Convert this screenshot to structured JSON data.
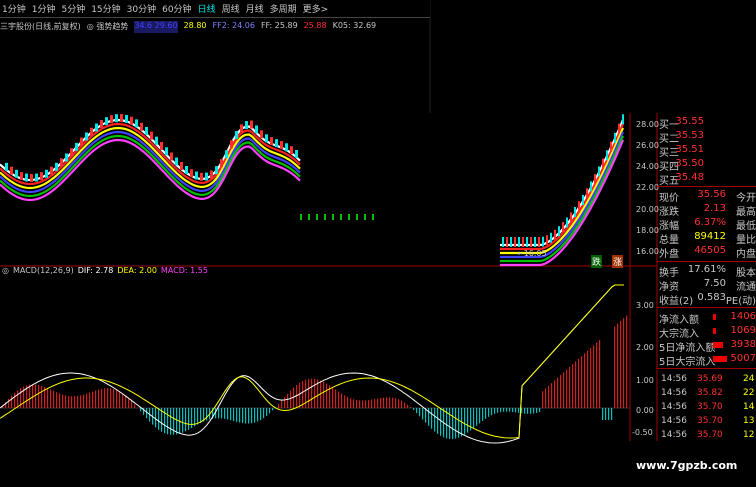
{
  "toolbar": {
    "tabs": [
      "1分钟",
      "1分钟",
      "5分钟",
      "15分钟",
      "30分钟",
      "60分钟",
      "日线",
      "周线",
      "月线",
      "多周期",
      "更多>"
    ],
    "active": "日线"
  },
  "indicator_info": {
    "title": "三宇股份(日线,前复权)",
    "indicator": "强势趋势",
    "values": [
      {
        "text": "34.6 29.60",
        "color": "#4040ff"
      },
      {
        "text": "28.80",
        "color": "#ffff00"
      },
      {
        "text": "FF2: 24.06",
        "color": "#8080ff"
      },
      {
        "text": "FF: 25.89",
        "color": "#c8c8c8"
      },
      {
        "text": "25.88",
        "color": "#ff3030"
      },
      {
        "text": "K05: 32.69",
        "color": "#c8c8c8"
      }
    ]
  },
  "price_axis": [
    "28.00",
    "26.00",
    "24.00",
    "22.00",
    "20.00",
    "18.00",
    "16.00"
  ],
  "low_marker": "16.05",
  "macd_legend": {
    "name": "MACD(12,26,9)",
    "dif": "DIF: 2.78",
    "dea": "DEA: 2.00",
    "macd": "MACD: 1.55"
  },
  "macd_axis": [
    "3.00",
    "2.00",
    "1.00",
    "0.00",
    "-0.50"
  ],
  "quote_panel": {
    "bids": [
      {
        "label": "买一",
        "price": "35.55"
      },
      {
        "label": "买二",
        "price": "35.53"
      },
      {
        "label": "买三",
        "price": "35.51"
      },
      {
        "label": "买四",
        "price": "35.50"
      },
      {
        "label": "买五",
        "price": "35.48"
      }
    ],
    "stats": [
      {
        "label": "现价",
        "value": "35.56",
        "label2": "今开",
        "color": "#ff3030"
      },
      {
        "label": "涨跌",
        "value": "2.13",
        "label2": "最高",
        "color": "#ff3030"
      },
      {
        "label": "涨幅",
        "value": "6.37%",
        "label2": "最低",
        "color": "#ff3030"
      },
      {
        "label": "总量",
        "value": "89412",
        "label2": "量比",
        "color": "#ffff00"
      },
      {
        "label": "外盘",
        "value": "46505",
        "label2": "内盘",
        "color": "#ff3030"
      }
    ],
    "turnover": [
      {
        "label": "换手",
        "value": "17.61%",
        "label2": "股本"
      },
      {
        "label": "净资",
        "value": "7.50",
        "label2": "流通"
      },
      {
        "label": "收益(2)",
        "value": "0.583",
        "label2": "PE(动)"
      }
    ],
    "flows": [
      {
        "label": "净流入额",
        "value": "1406"
      },
      {
        "label": "大宗流入",
        "value": "1069"
      },
      {
        "label": "5日净流入额",
        "value": "3938"
      },
      {
        "label": "5日大宗流入",
        "value": "5007"
      }
    ],
    "ticks": [
      {
        "time": "14:56",
        "price": "35.69",
        "vol": "24"
      },
      {
        "time": "14:56",
        "price": "35.82",
        "vol": "22"
      },
      {
        "time": "14:56",
        "price": "35.70",
        "vol": "14"
      },
      {
        "time": "14:56",
        "price": "35.70",
        "vol": "13"
      },
      {
        "time": "14:56",
        "price": "35.70",
        "vol": "12"
      }
    ]
  },
  "badges": {
    "left": "跌",
    "right": "涨"
  },
  "watermark": "www.7gpzb.com"
}
